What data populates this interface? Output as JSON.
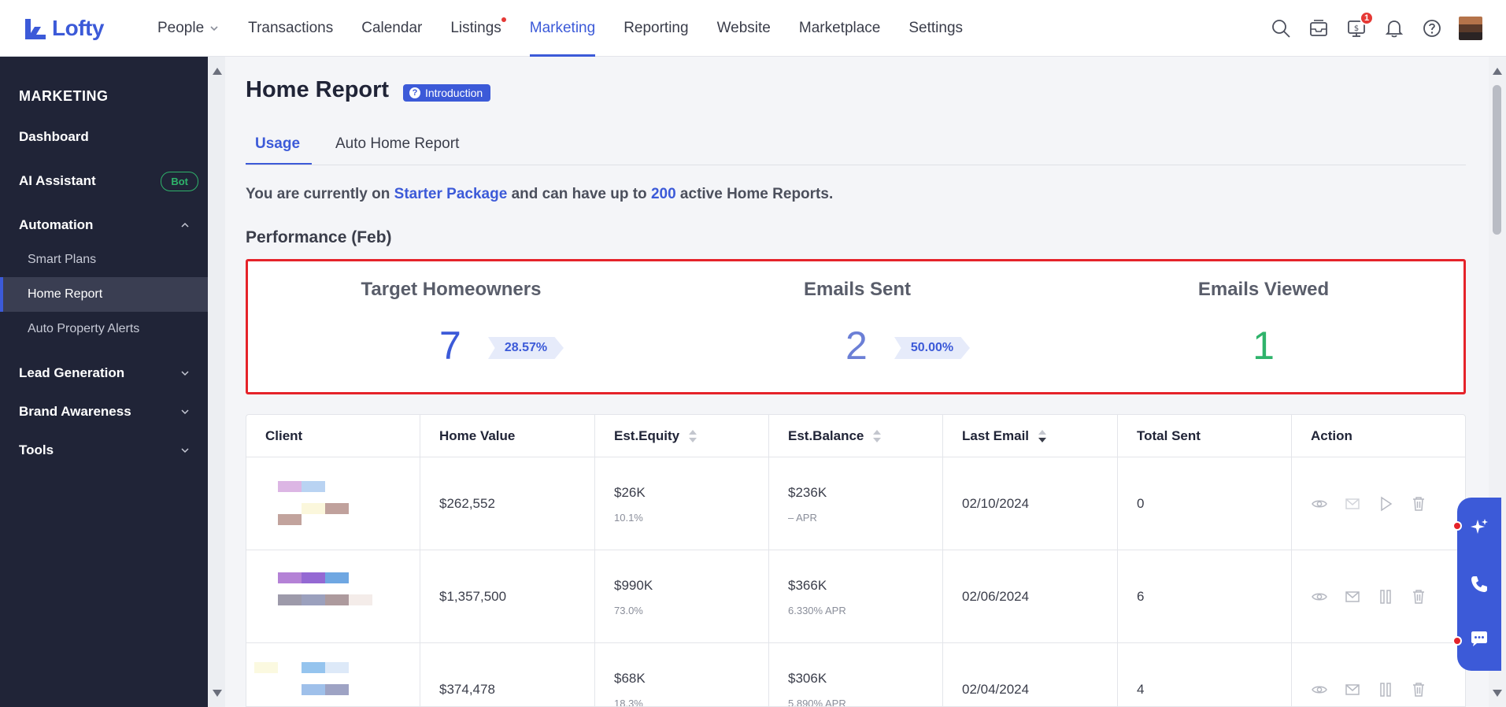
{
  "brand": {
    "name": "Lofty",
    "color": "#3c5ad8"
  },
  "nav": {
    "items": [
      {
        "label": "People",
        "has_dropdown": true
      },
      {
        "label": "Transactions"
      },
      {
        "label": "Calendar"
      },
      {
        "label": "Listings",
        "has_dot": true
      },
      {
        "label": "Marketing",
        "active": true
      },
      {
        "label": "Reporting"
      },
      {
        "label": "Website"
      },
      {
        "label": "Marketplace"
      },
      {
        "label": "Settings"
      }
    ],
    "icons": [
      "search-icon",
      "inbox-icon",
      "billing-icon",
      "bell-icon",
      "help-icon"
    ],
    "billing_badge": "1"
  },
  "sidebar": {
    "title": "MARKETING",
    "items": [
      {
        "label": "Dashboard"
      },
      {
        "label": "AI Assistant",
        "badge": "Bot"
      },
      {
        "label": "Automation",
        "expanded": true
      },
      {
        "label": "Smart Plans",
        "sub": true
      },
      {
        "label": "Home Report",
        "sub": true,
        "active": true
      },
      {
        "label": "Auto Property Alerts",
        "sub": true
      },
      {
        "label": "Lead Generation"
      },
      {
        "label": "Brand Awareness"
      },
      {
        "label": "Tools"
      }
    ]
  },
  "page": {
    "title": "Home Report",
    "intro_badge": "Introduction",
    "tabs": [
      {
        "label": "Usage",
        "active": true
      },
      {
        "label": "Auto Home Report"
      }
    ],
    "package": {
      "prefix": "You are currently on ",
      "package_name": "Starter Package",
      "middle": " and can have up to ",
      "limit": "200",
      "suffix": " active Home Reports."
    },
    "performance_title": "Performance (Feb)",
    "stats": [
      {
        "label": "Target Homeowners",
        "value": "7",
        "percent": "28.57%"
      },
      {
        "label": "Emails Sent",
        "value": "2",
        "percent": "50.00%"
      },
      {
        "label": "Emails Viewed",
        "value": "1"
      }
    ]
  },
  "table": {
    "columns": [
      {
        "label": "Client"
      },
      {
        "label": "Home Value"
      },
      {
        "label": "Est.Equity",
        "sortable": true
      },
      {
        "label": "Est.Balance",
        "sortable": true
      },
      {
        "label": "Last Email",
        "sortable": true,
        "sort": "desc"
      },
      {
        "label": "Total Sent"
      },
      {
        "label": "Action"
      }
    ],
    "rows": [
      {
        "home_value": "$262,552",
        "equity": "$26K",
        "equity_pct": "10.1%",
        "balance": "$236K",
        "balance_rate": "– APR",
        "last_email": "02/10/2024",
        "total_sent": "0",
        "action3": "play-icon"
      },
      {
        "home_value": "$1,357,500",
        "equity": "$990K",
        "equity_pct": "73.0%",
        "balance": "$366K",
        "balance_rate": "6.330% APR",
        "last_email": "02/06/2024",
        "total_sent": "6",
        "action3": "pause-icon"
      },
      {
        "home_value": "$374,478",
        "equity": "$68K",
        "equity_pct": "18.3%",
        "balance": "$306K",
        "balance_rate": "5.890% APR",
        "last_email": "02/04/2024",
        "total_sent": "4",
        "action3": "pause-icon"
      }
    ]
  },
  "colors": {
    "accent": "#3c5ad8",
    "highlight_border": "#e5232a",
    "success": "#2fb36b",
    "sidebar_bg": "#202437"
  }
}
